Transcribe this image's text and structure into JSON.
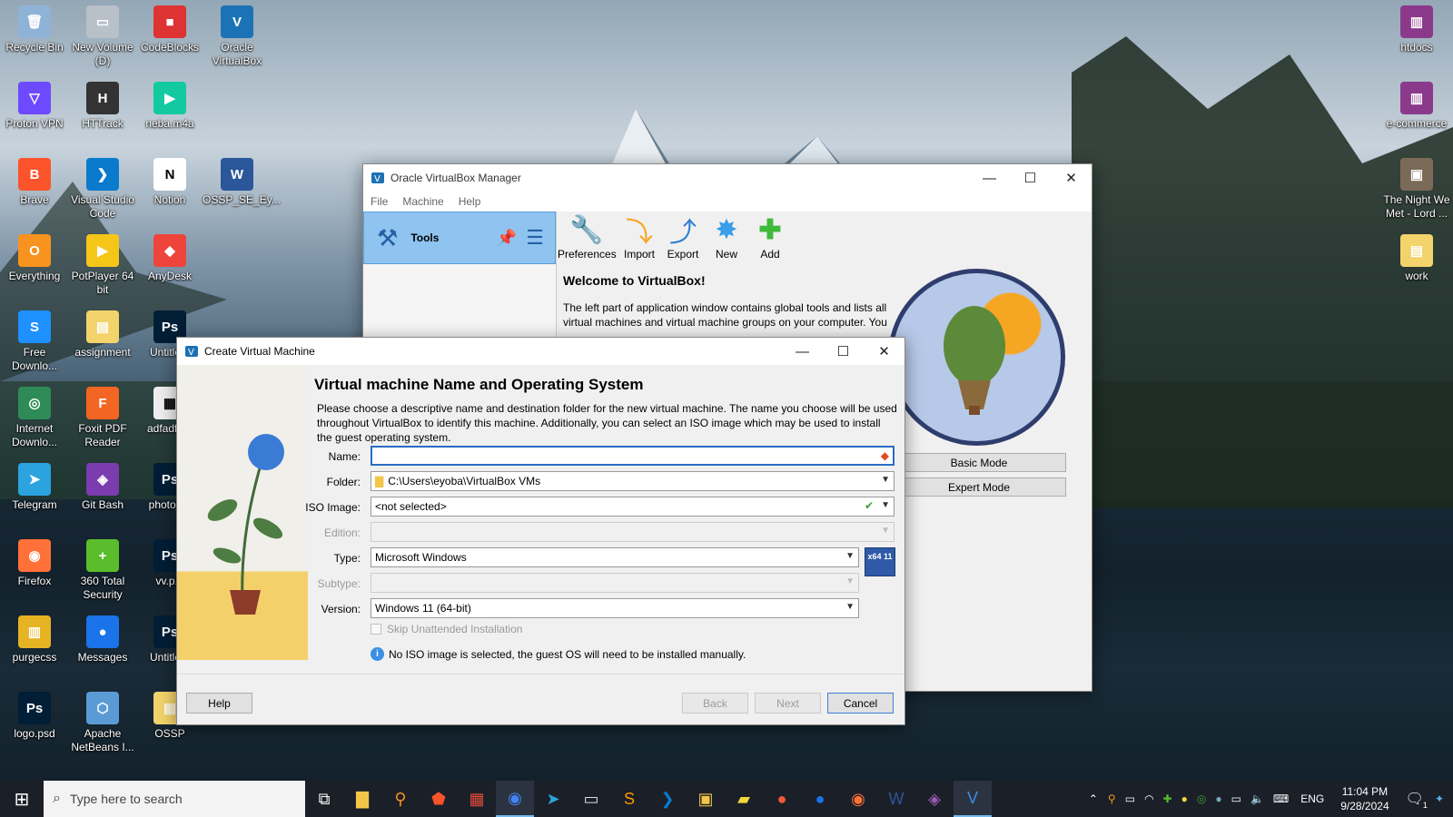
{
  "desktop_icons": [
    {
      "label": "Recycle Bin",
      "icon": "recycle-bin-icon",
      "color": "#8fb3d6",
      "glyph": "🗑"
    },
    {
      "label": "New Volume (D)",
      "icon": "drive-icon",
      "color": "#b8c0c8",
      "glyph": "▭"
    },
    {
      "label": "CodeBlocks",
      "icon": "codeblocks-icon",
      "color": "#d33",
      "glyph": "■"
    },
    {
      "label": "Oracle VirtualBox",
      "icon": "virtualbox-icon",
      "color": "#1b72b5",
      "glyph": "V"
    },
    {
      "label": "Proton VPN",
      "icon": "protonvpn-icon",
      "color": "#6d4aff",
      "glyph": "▽"
    },
    {
      "label": "HTTrack",
      "icon": "httrack-icon",
      "color": "#333",
      "glyph": "H"
    },
    {
      "label": "neba.m4a",
      "icon": "audio-file-icon",
      "color": "#13c9a0",
      "glyph": "▶"
    },
    {
      "label": "Brave",
      "icon": "brave-icon",
      "color": "#fb542b",
      "glyph": "B"
    },
    {
      "label": "Visual Studio Code",
      "icon": "vscode-icon",
      "color": "#0a7acc",
      "glyph": "❯"
    },
    {
      "label": "Notion",
      "icon": "notion-icon",
      "color": "#fff",
      "glyph": "N"
    },
    {
      "label": "OSSP_SE_Ey...",
      "icon": "word-doc-icon",
      "color": "#2b579a",
      "glyph": "W"
    },
    {
      "label": "Everything",
      "icon": "everything-icon",
      "color": "#f7931e",
      "glyph": "O"
    },
    {
      "label": "PotPlayer 64 bit",
      "icon": "potplayer-icon",
      "color": "#f5c518",
      "glyph": "▶"
    },
    {
      "label": "AnyDesk",
      "icon": "anydesk-icon",
      "color": "#ef443b",
      "glyph": "◆"
    },
    {
      "label": "Free Downlo...",
      "icon": "fdm-icon",
      "color": "#1e90ff",
      "glyph": "S"
    },
    {
      "label": "assignment",
      "icon": "folder-icon",
      "color": "#f3d36b",
      "glyph": "▤"
    },
    {
      "label": "Untitle...",
      "icon": "psd-icon",
      "color": "#001e36",
      "glyph": "Ps"
    },
    {
      "label": "Internet Downlo...",
      "icon": "idm-icon",
      "color": "#2e8b57",
      "glyph": "◎"
    },
    {
      "label": "Foxit PDF Reader",
      "icon": "foxit-icon",
      "color": "#f26522",
      "glyph": "F"
    },
    {
      "label": "adfadfa...",
      "icon": "file-icon",
      "color": "#eee",
      "glyph": "▦"
    },
    {
      "label": "Telegram",
      "icon": "telegram-icon",
      "color": "#2aa3df",
      "glyph": "➤"
    },
    {
      "label": "Git Bash",
      "icon": "gitbash-icon",
      "color": "#7a3cae",
      "glyph": "◈"
    },
    {
      "label": "photo_...",
      "icon": "psd-icon",
      "color": "#001e36",
      "glyph": "Ps"
    },
    {
      "label": "Firefox",
      "icon": "firefox-icon",
      "color": "#ff7139",
      "glyph": "◉"
    },
    {
      "label": "360 Total Security",
      "icon": "360-icon",
      "color": "#5bbd2b",
      "glyph": "+"
    },
    {
      "label": "vv.p...",
      "icon": "psd-icon",
      "color": "#001e36",
      "glyph": "Ps"
    },
    {
      "label": "purgecss",
      "icon": "zip-icon",
      "color": "#e6b422",
      "glyph": "▥"
    },
    {
      "label": "Messages",
      "icon": "messages-icon",
      "color": "#1a73e8",
      "glyph": "●"
    },
    {
      "label": "Untitle...",
      "icon": "psd-icon",
      "color": "#001e36",
      "glyph": "Ps"
    },
    {
      "label": "logo.psd",
      "icon": "psd-icon",
      "color": "#001e36",
      "glyph": "Ps"
    },
    {
      "label": "Apache NetBeans I...",
      "icon": "netbeans-icon",
      "color": "#5b9bd5",
      "glyph": "⬡"
    },
    {
      "label": "OSSP",
      "icon": "folder-icon",
      "color": "#f3d36b",
      "glyph": "▤"
    },
    {
      "label": "htdocs",
      "icon": "winrar-icon",
      "color": "#8b3a8b",
      "glyph": "▥"
    },
    {
      "label": "e-commerce",
      "icon": "winrar-icon",
      "color": "#8b3a8b",
      "glyph": "▥"
    },
    {
      "label": "The Night We Met - Lord ...",
      "icon": "media-file-icon",
      "color": "#7b6a58",
      "glyph": "▣"
    },
    {
      "label": "work",
      "icon": "folder-icon",
      "color": "#f3d36b",
      "glyph": "▤"
    }
  ],
  "manager": {
    "title": "Oracle VirtualBox Manager",
    "menu": [
      "File",
      "Machine",
      "Help"
    ],
    "tools_label": "Tools",
    "toolbar": [
      "Preferences",
      "Import",
      "Export",
      "New",
      "Add"
    ],
    "welcome_title": "Welcome to VirtualBox!",
    "welcome_text": "The left part of application window contains global tools and lists all virtual machines and virtual machine groups on your computer. You",
    "basic_mode": "Basic Mode",
    "expert_mode": "Expert Mode"
  },
  "dialog": {
    "title": "Create Virtual Machine",
    "heading": "Virtual machine Name and Operating System",
    "description": "Please choose a descriptive name and destination folder for the new virtual machine. The name you choose will be used throughout VirtualBox to identify this machine. Additionally, you can select an ISO image which may be used to install the guest operating system.",
    "labels": {
      "name": "Name:",
      "folder": "Folder:",
      "iso": "ISO Image:",
      "edition": "Edition:",
      "type": "Type:",
      "subtype": "Subtype:",
      "version": "Version:"
    },
    "values": {
      "name": "",
      "folder": "C:\\Users\\eyoba\\VirtualBox VMs",
      "iso": "<not selected>",
      "edition": "",
      "type": "Microsoft Windows",
      "subtype": "",
      "version": "Windows 11 (64-bit)"
    },
    "os_badge": "x64 11",
    "skip_unattended": "Skip Unattended Installation",
    "info": "No ISO image is selected, the guest OS will need to be installed manually.",
    "buttons": {
      "help": "Help",
      "back": "Back",
      "next": "Next",
      "cancel": "Cancel"
    }
  },
  "taskbar": {
    "search_placeholder": "Type here to search",
    "lang": "ENG",
    "time": "11:04 PM",
    "date": "9/28/2024",
    "notifications": "1"
  }
}
